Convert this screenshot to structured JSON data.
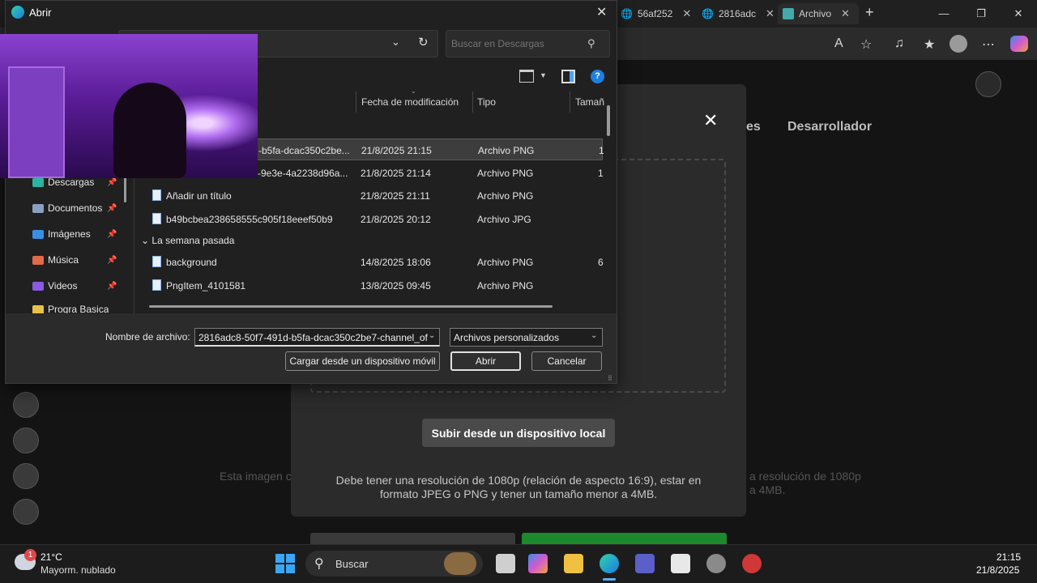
{
  "browser": {
    "tabs": [
      {
        "label": "56af252",
        "close": "✕"
      },
      {
        "label": "2816adc",
        "close": "✕"
      },
      {
        "label": "Archivo",
        "close": "✕"
      }
    ],
    "new_tab": "+",
    "window_controls": {
      "minimize": "—",
      "maximize": "❐",
      "close": "✕"
    }
  },
  "page": {
    "tab_partial": "es",
    "tab_developer": "Desarrollador",
    "modal_close": "✕",
    "upload_button": "Subir desde un dispositivo local",
    "note": "Debe tener una resolución de 1080p (relación de aspecto 16:9), estar en formato JPEG o PNG y tener un tamaño menor a 4MB.",
    "bg_note_left": "Esta imagen c",
    "bg_note_right_1": "a resolución de 1080p",
    "bg_note_right_2": "a 4MB."
  },
  "dialog": {
    "title": "Abrir",
    "close": "✕",
    "search_placeholder": "Buscar en Descargas",
    "help": "?",
    "columns": {
      "modified": "Fecha de modificación",
      "type": "Tipo",
      "size": "Tamañ"
    },
    "files": [
      {
        "name": "-b5fa-dcac350c2be...",
        "date": "21/8/2025 21:15",
        "type": "Archivo PNG",
        "size": "1",
        "selected": true
      },
      {
        "name": "-9e3e-4a2238d96a...",
        "date": "21/8/2025 21:14",
        "type": "Archivo PNG",
        "size": "1"
      },
      {
        "name": "Añadir un título",
        "date": "21/8/2025 21:11",
        "type": "Archivo PNG",
        "size": ""
      },
      {
        "name": "b49bcbea238658555c905f18eeef50b9",
        "date": "21/8/2025 20:12",
        "type": "Archivo JPG",
        "size": ""
      },
      {
        "name": "background",
        "date": "14/8/2025 18:06",
        "type": "Archivo PNG",
        "size": "6"
      },
      {
        "name": "PngItem_4101581",
        "date": "13/8/2025 09:45",
        "type": "Archivo PNG",
        "size": ""
      }
    ],
    "group_last_week": "La semana pasada",
    "nav": [
      {
        "label": "Descargas",
        "color": "#2bb5a0"
      },
      {
        "label": "Documentos",
        "color": "#8aa0c0"
      },
      {
        "label": "Imágenes",
        "color": "#3a8ee6"
      },
      {
        "label": "Música",
        "color": "#e06b4a"
      },
      {
        "label": "Videos",
        "color": "#8a5ae0"
      },
      {
        "label": "Progra Basica",
        "color": "#e8c04a"
      }
    ],
    "pin": "📌",
    "filename_label": "Nombre de archivo:",
    "filename_value": "2816adc8-50f7-491d-b5fa-dcac350c2be7-channel_of",
    "filetype_value": "Archivos personalizados",
    "btn_mobile": "Cargar desde un dispositivo móvil",
    "btn_open": "Abrir",
    "btn_cancel": "Cancelar"
  },
  "taskbar": {
    "weather_temp": "21°C",
    "weather_desc": "Mayorm. nublado",
    "weather_badge": "1",
    "search": "Buscar",
    "time": "21:15",
    "date": "21/8/2025"
  }
}
